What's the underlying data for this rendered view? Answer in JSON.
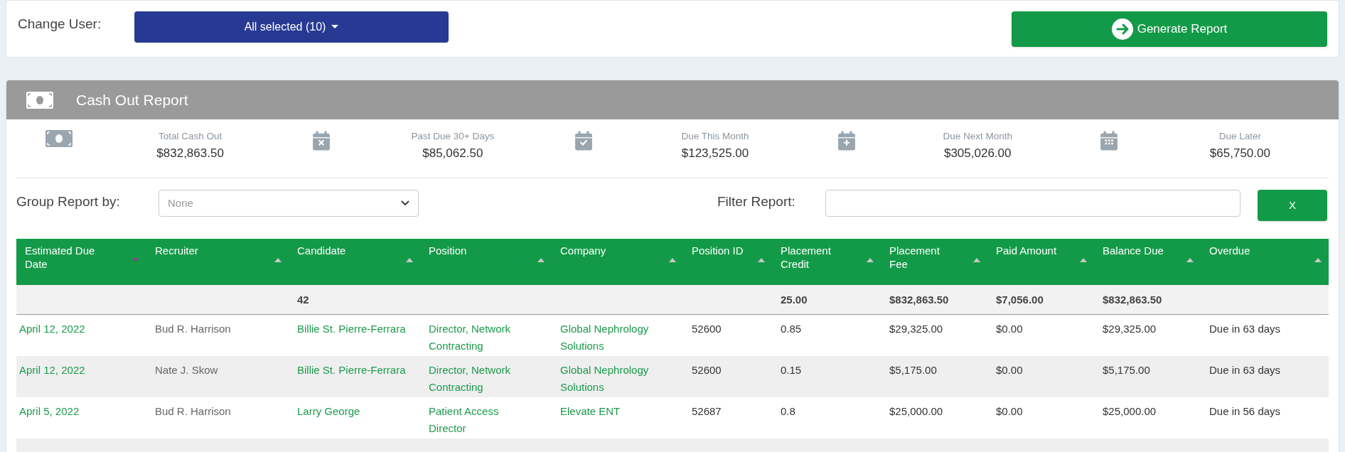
{
  "user_filter": {
    "label": "Change User:",
    "value": "All selected (10)"
  },
  "generate_button": "Generate Report",
  "report": {
    "title": "Cash Out Report",
    "stats": [
      {
        "kind": "money",
        "label": "Total Cash Out",
        "value": "$832,863.50"
      },
      {
        "kind": "past-due",
        "label": "Past Due 30+ Days",
        "value": "$85,062.50"
      },
      {
        "kind": "this-month",
        "label": "Due This Month",
        "value": "$123,525.00"
      },
      {
        "kind": "next-month",
        "label": "Due Next Month",
        "value": "$305,026.00"
      },
      {
        "kind": "later",
        "label": "Due Later",
        "value": "$65,750.00"
      }
    ],
    "group_by": {
      "label": "Group Report by:",
      "placeholder": "None"
    },
    "filter": {
      "label": "Filter Report:",
      "clear_button": "X"
    },
    "table": {
      "columns": [
        {
          "label": "Estimated Due Date",
          "sorted": true
        },
        {
          "label": "Recruiter",
          "sorted": false
        },
        {
          "label": "Candidate",
          "sorted": false
        },
        {
          "label": "Position",
          "sorted": false
        },
        {
          "label": "Company",
          "sorted": false
        },
        {
          "label": "Position ID",
          "sorted": false
        },
        {
          "label": "Placement Credit",
          "sorted": false
        },
        {
          "label": "Placement Fee",
          "sorted": false
        },
        {
          "label": "Paid Amount",
          "sorted": false
        },
        {
          "label": "Balance Due",
          "sorted": false
        },
        {
          "label": "Overdue",
          "sorted": false
        }
      ],
      "totals": {
        "candidate": "42",
        "placement_credit": "25.00",
        "placement_fee": "$832,863.50",
        "paid_amount": "$7,056.00",
        "balance_due": "$832,863.50"
      },
      "rows": [
        [
          "April 12, 2022",
          "Bud R. Harrison",
          "Billie St. Pierre-Ferrara",
          "Director, Network Contracting",
          "Global Nephrology Solutions",
          "52600",
          "0.85",
          "$29,325.00",
          "$0.00",
          "$29,325.00",
          "Due in 63 days"
        ],
        [
          "April 12, 2022",
          "Nate J. Skow",
          "Billie St. Pierre-Ferrara",
          "Director, Network Contracting",
          "Global Nephrology Solutions",
          "52600",
          "0.15",
          "$5,175.00",
          "$0.00",
          "$5,175.00",
          "Due in 63 days"
        ],
        [
          "April 5, 2022",
          "Bud R. Harrison",
          "Larry George",
          "Patient Access Director",
          "Elevate ENT",
          "52687",
          "0.8",
          "$25,000.00",
          "$0.00",
          "$25,000.00",
          "Due in 56 days"
        ]
      ]
    }
  }
}
